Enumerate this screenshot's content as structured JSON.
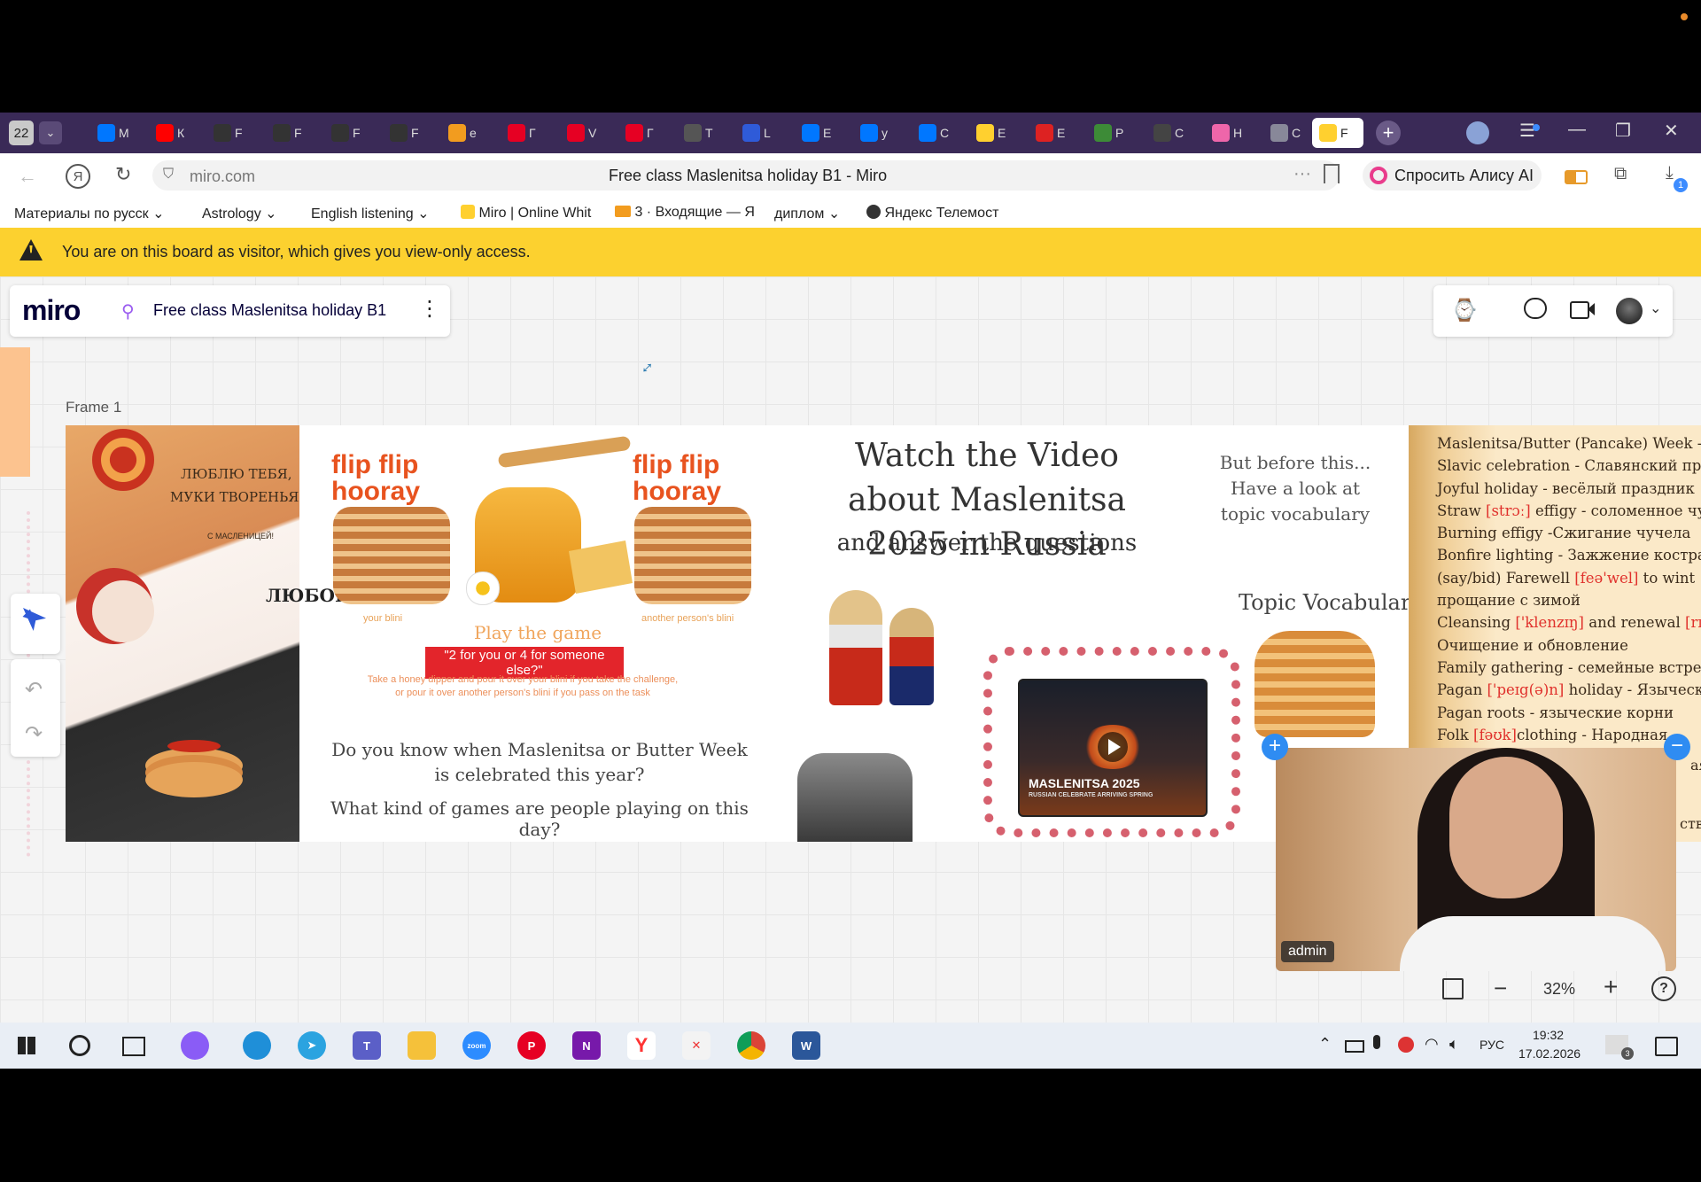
{
  "tabs": {
    "counter": "22",
    "items": [
      {
        "label": "М",
        "icon": "vk-icon",
        "color": "#0077ff"
      },
      {
        "label": "К",
        "icon": "youtube-icon",
        "color": "#ff0000"
      },
      {
        "label": "F",
        "icon": "isl-icon",
        "color": "#333"
      },
      {
        "label": "F",
        "icon": "isl-icon",
        "color": "#333"
      },
      {
        "label": "F",
        "icon": "isl-icon",
        "color": "#333"
      },
      {
        "label": "F",
        "icon": "isl-icon",
        "color": "#333"
      },
      {
        "label": "e",
        "icon": "orange-icon",
        "color": "#f29c1f"
      },
      {
        "label": "Г",
        "icon": "pinterest-icon",
        "color": "#e60023"
      },
      {
        "label": "V",
        "icon": "pinterest-icon",
        "color": "#e60023"
      },
      {
        "label": "Г",
        "icon": "pinterest-icon",
        "color": "#e60023"
      },
      {
        "label": "Т",
        "icon": "t-icon",
        "color": "#555"
      },
      {
        "label": "L",
        "icon": "c-icon",
        "color": "#2f5bd8"
      },
      {
        "label": "Е",
        "icon": "vk-icon",
        "color": "#0077ff"
      },
      {
        "label": "y",
        "icon": "vk-icon",
        "color": "#0077ff"
      },
      {
        "label": "С",
        "icon": "vk-icon",
        "color": "#0077ff"
      },
      {
        "label": "Е",
        "icon": "miro-icon",
        "color": "#ffd02f"
      },
      {
        "label": "Е",
        "icon": "ru-icon",
        "color": "#d22"
      },
      {
        "label": "Р",
        "icon": "green-icon",
        "color": "#3d8b37"
      },
      {
        "label": "С",
        "icon": "home-icon",
        "color": "#444"
      },
      {
        "label": "Н",
        "icon": "rainbow-icon",
        "color": "#e6a"
      },
      {
        "label": "С",
        "icon": "leaf-icon",
        "color": "#889"
      },
      {
        "label": "F",
        "icon": "miro-icon",
        "color": "#ffd02f"
      }
    ]
  },
  "address": {
    "url": "miro.com",
    "page_title": "Free class Maslenitsa holiday B1 - Miro",
    "alice_label": "Спросить Алису AI",
    "download_badge": "1"
  },
  "bookmarks": [
    {
      "label": "Материалы по русск"
    },
    {
      "label": "Astrology"
    },
    {
      "label": "English listening"
    },
    {
      "label": "Miro | Online Whit"
    },
    {
      "label": "3 · Входящие — Я"
    },
    {
      "label": "диплом"
    },
    {
      "label": "Яндекс Телемост"
    }
  ],
  "visitor_banner": "You are on this board as visitor, which gives you view-only access.",
  "board": {
    "logo": "miro",
    "title": "Free class Maslenitsa holiday B1",
    "frame_label": "Frame 1",
    "zoom": "32%"
  },
  "slide": {
    "art_text1": "ЛЮБЛЮ ТЕБЯ,",
    "art_text2": "МУКИ ТВОРЕНЬЯ",
    "art_small": "С МАСЛЕНИЦЕЙ!",
    "art_side": "ЛЮБОВ",
    "flip_text": "flip flip hooray",
    "your_blini": "your blini",
    "other_blini": "another person's blini",
    "play_game": "Play the game",
    "game_question": "\"2 for you or 4 for someone else?\"",
    "game_rules": "Take a honey dipper and pour it over your blini if you take the challenge, or pour it over another person's blini if you pass on the task",
    "q1": "Do you know when Maslenitsa or Butter Week  is celebrated this year?",
    "q2": "What kind of games are people playing on this day?",
    "watch_title": "Watch the Video about Maslenitsa 2025 in Russia",
    "answer": "and answer the questions",
    "video_title": "MASLENITSA 2025",
    "video_subtitle": "RUSSIAN CELEBRATE ARRIVING SPRING",
    "before": "But before this... Have a look at topic vocabulary",
    "topic_vocab": "Topic Vocabulary",
    "vocab": [
      {
        "parts": [
          "Maslenitsa/Butter (Pancake) Week -"
        ]
      },
      {
        "parts": [
          "Slavic celebration - Славянский празд"
        ]
      },
      {
        "parts": [
          "Joyful holiday - весёлый праздник"
        ]
      },
      {
        "parts": [
          "Straw ",
          "[strɔː]",
          " effigy - соломенное чу"
        ]
      },
      {
        "parts": [
          "Burning effigy -Сжигание чучела"
        ]
      },
      {
        "parts": [
          "Bonfire lighting - Зажжение костра"
        ]
      },
      {
        "parts": [
          "(say/bid) Farewell ",
          "[feə'wel]",
          " to wint"
        ]
      },
      {
        "parts": [
          "прощание с зимой"
        ]
      },
      {
        "parts": [
          "Cleansing ",
          "['klenzɪŋ]",
          " and renewal ",
          "[rɪ"
        ]
      },
      {
        "parts": [
          "Очищение и обновление"
        ]
      },
      {
        "parts": [
          "Family gathering - семейные встреч"
        ]
      },
      {
        "parts": [
          "Pagan ",
          "['peɪg(ə)n]",
          " holiday - Языческ"
        ]
      },
      {
        "parts": [
          "Pagan roots - языческие корни"
        ]
      },
      {
        "parts": [
          "Folk ",
          "[fəʊk]",
          "clothing - Народная"
        ]
      }
    ],
    "vocab_tail1": "ая",
    "vocab_tail2": "ств"
  },
  "video_call": {
    "name": "admin"
  },
  "taskbar": {
    "lang": "РУС",
    "time": "19:32",
    "date": "17.02.2026",
    "notif_count": "3"
  }
}
